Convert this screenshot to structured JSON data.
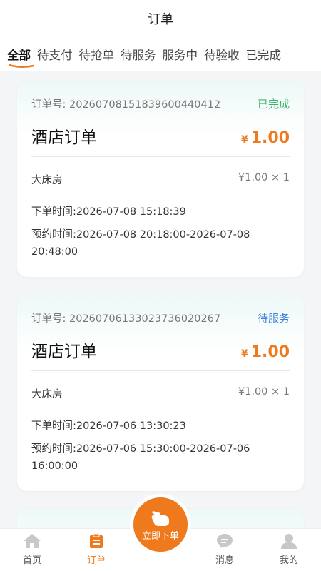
{
  "header": {
    "title": "订单"
  },
  "tabs": [
    {
      "label": "全部",
      "active": true
    },
    {
      "label": "待支付",
      "active": false
    },
    {
      "label": "待抢单",
      "active": false
    },
    {
      "label": "待服务",
      "active": false
    },
    {
      "label": "服务中",
      "active": false
    },
    {
      "label": "待验收",
      "active": false
    },
    {
      "label": "已完成",
      "active": false
    }
  ],
  "orders": [
    {
      "order_no": "订单号: 20260708151839600440412",
      "status": "已完成",
      "status_color": "#3bb56a",
      "title": "酒店订单",
      "currency": "¥",
      "amount": "1.00",
      "item_name": "大床房",
      "item_price": "¥1.00 × 1",
      "order_time": "下单时间:2026-07-08 15:18:39",
      "book_time": "预约时间:2026-07-08 20:18:00-2026-07-08 20:48:00"
    },
    {
      "order_no": "订单号: 20260706133023736020267",
      "status": "待服务",
      "status_color": "#3b7fd9",
      "title": "酒店订单",
      "currency": "¥",
      "amount": "1.00",
      "item_name": "大床房",
      "item_price": "¥1.00 × 1",
      "order_time": "下单时间:2026-07-06 13:30:23",
      "book_time": "预约时间:2026-07-06 15:30:00-2026-07-06 16:00:00"
    }
  ],
  "bottom_nav": {
    "home": {
      "label": "首页",
      "icon": "home-icon"
    },
    "orders": {
      "label": "订单",
      "icon": "orders-icon"
    },
    "messages": {
      "label": "消息",
      "icon": "message-icon"
    },
    "mine": {
      "label": "我的",
      "icon": "user-icon"
    }
  },
  "fab": {
    "label": "立即下单",
    "icon": "hand-icon"
  },
  "colors": {
    "accent": "#ef7a1e",
    "icon_gray": "#c8c8c8"
  }
}
